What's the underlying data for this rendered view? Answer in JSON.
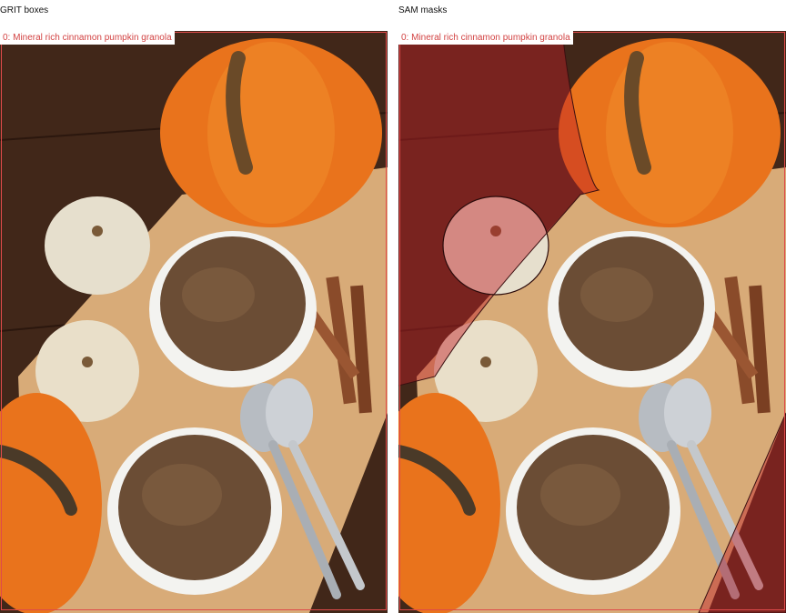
{
  "panels": [
    {
      "title": "GRIT boxes",
      "label": "0: Mineral rich cinnamon pumpkin granola"
    },
    {
      "title": "SAM masks",
      "label": "0: Mineral rich cinnamon pumpkin granola"
    }
  ],
  "colors": {
    "box": "#e04a4a",
    "label_text": "#d24242",
    "mask_tint": "rgba(190,30,40,0.45)"
  }
}
